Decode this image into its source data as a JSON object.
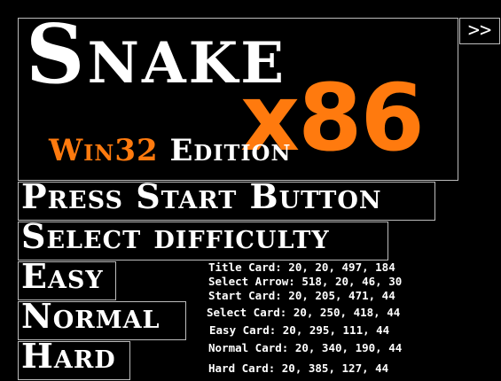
{
  "title_card": {
    "title": "Snake",
    "version": "x86",
    "edition_platform": "Win32",
    "edition_word": "Edition"
  },
  "select_arrow": {
    "label": ">>",
    "icon": "double-chevron-right-icon"
  },
  "menu": {
    "start": "Press Start Button",
    "select_difficulty": "Select difficulty",
    "easy": "Easy",
    "normal": "Normal",
    "hard": "Hard"
  },
  "debug_overlay": [
    "Title Card: 20, 20, 497, 184",
    "Select Arrow: 518, 20, 46, 30",
    "Start Card: 20, 205, 471, 44",
    "Select Card: 20, 250, 418, 44",
    "Easy Card: 20, 295, 111, 44",
    "Normal Card: 20, 340, 190, 44",
    "Hard Card: 20, 385, 127, 44"
  ],
  "colors": {
    "background": "#000000",
    "text": "#ffffff",
    "accent": "#ff7a0e",
    "card_border": "#bdbdbd"
  }
}
